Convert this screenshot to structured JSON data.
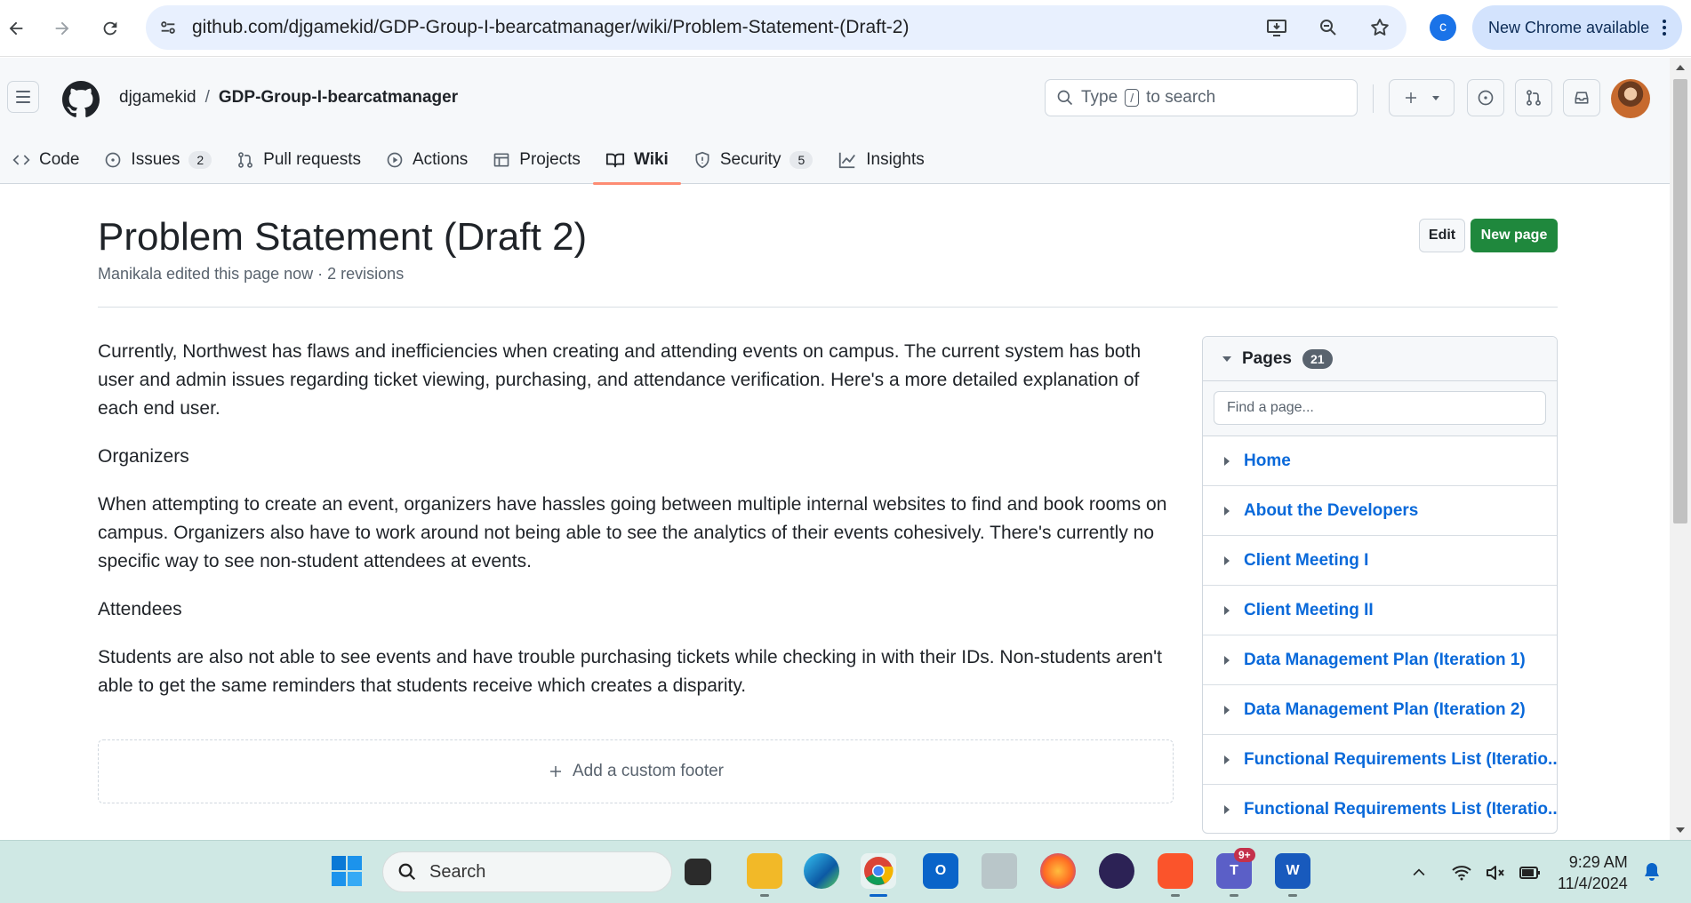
{
  "browser": {
    "url": "github.com/djgamekid/GDP-Group-I-bearcatmanager/wiki/Problem-Statement-(Draft-2)",
    "profile_initial": "c",
    "update_label": "New Chrome available"
  },
  "repo": {
    "owner": "djgamekid",
    "separator": "/",
    "name": "GDP-Group-I-bearcatmanager",
    "search_prefix": "Type",
    "search_key": "/",
    "search_suffix": "to search"
  },
  "tabs": [
    {
      "label": "Code",
      "icon": "code-icon"
    },
    {
      "label": "Issues",
      "icon": "issue-icon",
      "count": "2"
    },
    {
      "label": "Pull requests",
      "icon": "pull-request-icon"
    },
    {
      "label": "Actions",
      "icon": "play-icon"
    },
    {
      "label": "Projects",
      "icon": "table-icon"
    },
    {
      "label": "Wiki",
      "icon": "book-icon",
      "active": true
    },
    {
      "label": "Security",
      "icon": "shield-icon",
      "count": "5"
    },
    {
      "label": "Insights",
      "icon": "graph-icon"
    }
  ],
  "page": {
    "title": "Problem Statement (Draft 2)",
    "meta": "Manikala edited this page now · 2 revisions",
    "edit_label": "Edit",
    "new_page_label": "New page",
    "paragraphs": [
      "Currently, Northwest has flaws and inefficiencies when creating and attending events on campus. The current system has both user and admin issues regarding ticket viewing, purchasing, and attendance verification. Here's a more detailed explanation of each end user.",
      "Organizers",
      "When attempting to create an event, organizers have hassles going between multiple internal websites to find and book rooms on campus. Organizers also have to work around not being able to see the analytics of their events cohesively. There's currently no specific way to see non-student attendees at events.",
      "Attendees",
      "Students are also not able to see events and have trouble purchasing tickets while checking in with their IDs. Non-students aren't able to get the same reminders that students receive which creates a disparity."
    ],
    "footer_add_label": "Add a custom footer"
  },
  "sidebar": {
    "title": "Pages",
    "count": "21",
    "find_placeholder": "Find a page...",
    "items": [
      "Home",
      "About the Developers",
      "Client Meeting I",
      "Client Meeting II",
      "Data Management Plan (Iteration 1)",
      "Data Management Plan (Iteration 2)",
      "Functional Requirements List (Iteratio...",
      "Functional Requirements List (Iteratio..."
    ]
  },
  "taskbar": {
    "search_label": "Search",
    "time": "9:29 AM",
    "date": "11/4/2024",
    "teams_badge": "9+"
  },
  "colors": {
    "accent_green": "#1f883d",
    "link_blue": "#0969da",
    "tab_underline": "#fd8c73"
  }
}
